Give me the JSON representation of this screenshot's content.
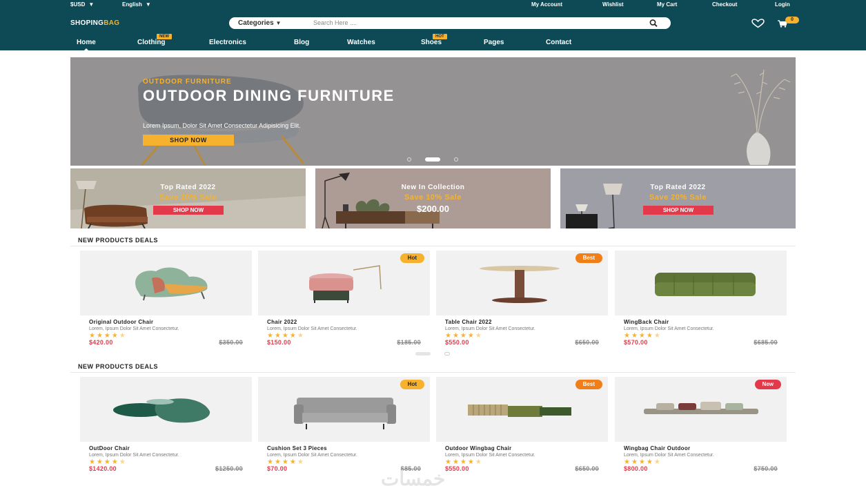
{
  "utility_bar": {
    "currency": "$USD",
    "language": "English",
    "links": [
      "My Account",
      "Wishlist",
      "My Cart",
      "Checkout",
      "Login"
    ]
  },
  "header": {
    "logo_main": "SHOPING",
    "logo_accent": "BAG",
    "search": {
      "category_label": "Categories",
      "placeholder": "Search Here ...."
    },
    "cart_count": "0"
  },
  "nav": {
    "items": [
      {
        "label": "Home",
        "active": true
      },
      {
        "label": "Clothing",
        "tag": "NEW"
      },
      {
        "label": "Electronics"
      },
      {
        "label": "Blog"
      },
      {
        "label": "Watches"
      },
      {
        "label": "Shoes",
        "tag": "HOT"
      },
      {
        "label": "Pages"
      },
      {
        "label": "Contact"
      }
    ]
  },
  "hero": {
    "subtitle": "OUTDOOR FURNITURE",
    "title": "OUTDOOR DINING FURNITURE",
    "description": "Lorem Ipsum, Dolor Sit Amet Consectetur Adipisicing Elit.",
    "button": "SHOP NOW",
    "slides": 3,
    "active_slide": 2
  },
  "promos": [
    {
      "title": "Top Rated 2022",
      "offer": "Save 20% Sale",
      "button": "SHOP NOW",
      "bg": "#b7b1a4"
    },
    {
      "title": "New In Collection",
      "offer": "Save 10% Sale",
      "price": "$200.00",
      "bg": "#ad9c95"
    },
    {
      "title": "Top Rated 2022",
      "offer": "Save 20% Sale",
      "button": "SHOP NOW",
      "bg": "#9e9ea7"
    }
  ],
  "sections": [
    {
      "title": "NEW PRODUCTS DEALS",
      "products": [
        {
          "name": "Original Outdoor Chair",
          "desc": "Lorem, Ipsum Dolor Sit Amet Consectetur.",
          "rating": 4.5,
          "price": "$420.00",
          "old_price": "$350.00",
          "tag": "",
          "icon": "lounge-chair-icon"
        },
        {
          "name": "Chair 2022",
          "desc": "Lorem, Ipsum Dolor Sit Amet Consectetur.",
          "rating": 4.5,
          "price": "$150.00",
          "old_price": "$185.00",
          "tag": "Hot",
          "icon": "stool-icon"
        },
        {
          "name": "Table Chair 2022",
          "desc": "Lorem, Ipsum Dolor Sit Amet Consectetur.",
          "rating": 4.5,
          "price": "$550.00",
          "old_price": "$650.00",
          "tag": "Best",
          "icon": "table-icon"
        },
        {
          "name": "WingBack Chair",
          "desc": "Lorem, Ipsum Dolor Sit Amet Consectetur.",
          "rating": 4.5,
          "price": "$570.00",
          "old_price": "$685.00",
          "tag": "",
          "icon": "sofa-icon"
        }
      ]
    },
    {
      "title": "NEW PRODUCTS DEALS",
      "products": [
        {
          "name": "OutDoor Chair",
          "desc": "Lorem, Ipsum Dolor Sit Amet Consectetur.",
          "rating": 4.5,
          "price": "$1420.00",
          "old_price": "$1250.00",
          "tag": "",
          "icon": "ottoman-icon"
        },
        {
          "name": "Cushion Set 3 Pieces",
          "desc": "Lorem, Ipsum Dolor Sit Amet Consectetur.",
          "rating": 4.5,
          "price": "$70.00",
          "old_price": "$85.00",
          "tag": "Hot",
          "icon": "armchair-icon"
        },
        {
          "name": "Outdoor Wingbag Chair",
          "desc": "Lorem, Ipsum Dolor Sit Amet Consectetur.",
          "rating": 4.5,
          "price": "$550.00",
          "old_price": "$650.00",
          "tag": "Best",
          "icon": "modular-sofa-icon"
        },
        {
          "name": "Wingbag Chair Outdoor",
          "desc": "Lorem, Ipsum Dolor Sit Amet Consectetur.",
          "rating": 4.5,
          "price": "$800.00",
          "old_price": "$750.00",
          "tag": "New",
          "icon": "sectional-sofa-icon"
        }
      ]
    }
  ],
  "watermark": "خمسات",
  "colors": {
    "header_bg": "#0d4a55",
    "accent": "#f6b22e",
    "sale_red": "#e23a4a",
    "best_orange": "#f07f1a"
  }
}
